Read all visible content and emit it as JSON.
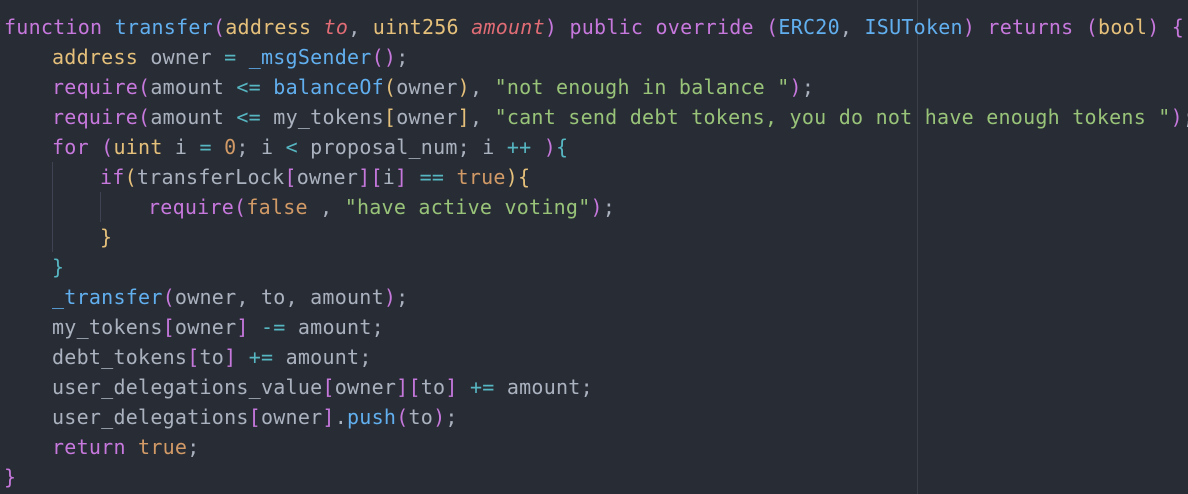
{
  "editor": {
    "background": "#282c34",
    "theme_colors": {
      "keyword": "#c678dd",
      "type": "#e5c07b",
      "function": "#61afef",
      "parameter": "#e06c75",
      "string": "#98c379",
      "number": "#d19a66",
      "operator": "#56b6c2",
      "plain": "#abb2bf"
    },
    "lines": [
      {
        "indent": 0,
        "tokens": [
          {
            "t": "function",
            "c": "#c678dd"
          },
          {
            "t": " ",
            "c": "#abb2bf"
          },
          {
            "t": "transfer",
            "c": "#61afef"
          },
          {
            "t": "(",
            "c": "#c678dd"
          },
          {
            "t": "address",
            "c": "#e5c07b"
          },
          {
            "t": " ",
            "c": "#abb2bf"
          },
          {
            "t": "to",
            "c": "#e06c75",
            "italic": true
          },
          {
            "t": ", ",
            "c": "#abb2bf"
          },
          {
            "t": "uint256",
            "c": "#e5c07b"
          },
          {
            "t": " ",
            "c": "#abb2bf"
          },
          {
            "t": "amount",
            "c": "#e06c75",
            "italic": true
          },
          {
            "t": ")",
            "c": "#c678dd"
          },
          {
            "t": " public override ",
            "c": "#c678dd"
          },
          {
            "t": "(",
            "c": "#c678dd"
          },
          {
            "t": "ERC20",
            "c": "#61afef"
          },
          {
            "t": ", ",
            "c": "#abb2bf"
          },
          {
            "t": "ISUToken",
            "c": "#61afef"
          },
          {
            "t": ")",
            "c": "#c678dd"
          },
          {
            "t": " returns ",
            "c": "#c678dd"
          },
          {
            "t": "(",
            "c": "#c678dd"
          },
          {
            "t": "bool",
            "c": "#e5c07b"
          },
          {
            "t": ")",
            "c": "#c678dd"
          },
          {
            "t": " ",
            "c": "#abb2bf"
          },
          {
            "t": "{",
            "c": "#c678dd"
          }
        ]
      },
      {
        "indent": 1,
        "tokens": [
          {
            "t": "address",
            "c": "#e5c07b"
          },
          {
            "t": " owner ",
            "c": "#abb2bf"
          },
          {
            "t": "=",
            "c": "#56b6c2"
          },
          {
            "t": " ",
            "c": "#abb2bf"
          },
          {
            "t": "_msgSender",
            "c": "#61afef"
          },
          {
            "t": "()",
            "c": "#c678dd"
          },
          {
            "t": ";",
            "c": "#abb2bf"
          }
        ]
      },
      {
        "indent": 1,
        "tokens": [
          {
            "t": "require",
            "c": "#c678dd"
          },
          {
            "t": "(",
            "c": "#c678dd"
          },
          {
            "t": "amount ",
            "c": "#abb2bf"
          },
          {
            "t": "<=",
            "c": "#56b6c2"
          },
          {
            "t": " ",
            "c": "#abb2bf"
          },
          {
            "t": "balanceOf",
            "c": "#61afef"
          },
          {
            "t": "(",
            "c": "#e5c07b"
          },
          {
            "t": "owner",
            "c": "#abb2bf"
          },
          {
            "t": ")",
            "c": "#e5c07b"
          },
          {
            "t": ", ",
            "c": "#abb2bf"
          },
          {
            "t": "\"not enough in balance \"",
            "c": "#98c379"
          },
          {
            "t": ")",
            "c": "#c678dd"
          },
          {
            "t": ";",
            "c": "#abb2bf"
          }
        ]
      },
      {
        "indent": 1,
        "tokens": [
          {
            "t": "require",
            "c": "#c678dd"
          },
          {
            "t": "(",
            "c": "#c678dd"
          },
          {
            "t": "amount ",
            "c": "#abb2bf"
          },
          {
            "t": "<=",
            "c": "#56b6c2"
          },
          {
            "t": " my_tokens",
            "c": "#abb2bf"
          },
          {
            "t": "[",
            "c": "#e5c07b"
          },
          {
            "t": "owner",
            "c": "#abb2bf"
          },
          {
            "t": "]",
            "c": "#e5c07b"
          },
          {
            "t": ", ",
            "c": "#abb2bf"
          },
          {
            "t": "\"cant send debt tokens, you do not have enough tokens \"",
            "c": "#98c379"
          },
          {
            "t": ")",
            "c": "#c678dd"
          },
          {
            "t": ";",
            "c": "#abb2bf"
          }
        ]
      },
      {
        "indent": 1,
        "tokens": [
          {
            "t": "for",
            "c": "#c678dd"
          },
          {
            "t": " ",
            "c": "#abb2bf"
          },
          {
            "t": "(",
            "c": "#c678dd"
          },
          {
            "t": "uint",
            "c": "#e5c07b"
          },
          {
            "t": " i ",
            "c": "#abb2bf"
          },
          {
            "t": "=",
            "c": "#56b6c2"
          },
          {
            "t": " ",
            "c": "#abb2bf"
          },
          {
            "t": "0",
            "c": "#d19a66"
          },
          {
            "t": "; i ",
            "c": "#abb2bf"
          },
          {
            "t": "<",
            "c": "#56b6c2"
          },
          {
            "t": " proposal_num; i ",
            "c": "#abb2bf"
          },
          {
            "t": "++",
            "c": "#56b6c2"
          },
          {
            "t": " ",
            "c": "#abb2bf"
          },
          {
            "t": ")",
            "c": "#c678dd"
          },
          {
            "t": "{",
            "c": "#56b6c2"
          }
        ]
      },
      {
        "indent": 2,
        "tokens": [
          {
            "t": "if",
            "c": "#c678dd"
          },
          {
            "t": "(",
            "c": "#e5c07b"
          },
          {
            "t": "transferLock",
            "c": "#abb2bf"
          },
          {
            "t": "[",
            "c": "#c678dd"
          },
          {
            "t": "owner",
            "c": "#abb2bf"
          },
          {
            "t": "][",
            "c": "#c678dd"
          },
          {
            "t": "i",
            "c": "#abb2bf"
          },
          {
            "t": "]",
            "c": "#c678dd"
          },
          {
            "t": " ",
            "c": "#abb2bf"
          },
          {
            "t": "==",
            "c": "#56b6c2"
          },
          {
            "t": " ",
            "c": "#abb2bf"
          },
          {
            "t": "true",
            "c": "#d19a66"
          },
          {
            "t": ")",
            "c": "#e5c07b"
          },
          {
            "t": "{",
            "c": "#e5c07b"
          }
        ]
      },
      {
        "indent": 3,
        "tokens": [
          {
            "t": "require",
            "c": "#c678dd"
          },
          {
            "t": "(",
            "c": "#c678dd"
          },
          {
            "t": "false",
            "c": "#d19a66"
          },
          {
            "t": " , ",
            "c": "#abb2bf"
          },
          {
            "t": "\"have active voting\"",
            "c": "#98c379"
          },
          {
            "t": ")",
            "c": "#c678dd"
          },
          {
            "t": ";",
            "c": "#abb2bf"
          }
        ]
      },
      {
        "indent": 2,
        "tokens": [
          {
            "t": "}",
            "c": "#e5c07b"
          }
        ]
      },
      {
        "indent": 1,
        "tokens": [
          {
            "t": "}",
            "c": "#56b6c2"
          }
        ]
      },
      {
        "indent": 1,
        "tokens": [
          {
            "t": "_transfer",
            "c": "#61afef"
          },
          {
            "t": "(",
            "c": "#c678dd"
          },
          {
            "t": "owner, to, amount",
            "c": "#abb2bf"
          },
          {
            "t": ")",
            "c": "#c678dd"
          },
          {
            "t": ";",
            "c": "#abb2bf"
          }
        ]
      },
      {
        "indent": 1,
        "tokens": [
          {
            "t": "my_tokens",
            "c": "#abb2bf"
          },
          {
            "t": "[",
            "c": "#c678dd"
          },
          {
            "t": "owner",
            "c": "#abb2bf"
          },
          {
            "t": "]",
            "c": "#c678dd"
          },
          {
            "t": " ",
            "c": "#abb2bf"
          },
          {
            "t": "-=",
            "c": "#56b6c2"
          },
          {
            "t": " amount;",
            "c": "#abb2bf"
          }
        ]
      },
      {
        "indent": 1,
        "tokens": [
          {
            "t": "debt_tokens",
            "c": "#abb2bf"
          },
          {
            "t": "[",
            "c": "#c678dd"
          },
          {
            "t": "to",
            "c": "#abb2bf"
          },
          {
            "t": "]",
            "c": "#c678dd"
          },
          {
            "t": " ",
            "c": "#abb2bf"
          },
          {
            "t": "+=",
            "c": "#56b6c2"
          },
          {
            "t": " amount;",
            "c": "#abb2bf"
          }
        ]
      },
      {
        "indent": 1,
        "tokens": [
          {
            "t": "user_delegations_value",
            "c": "#abb2bf"
          },
          {
            "t": "[",
            "c": "#c678dd"
          },
          {
            "t": "owner",
            "c": "#abb2bf"
          },
          {
            "t": "][",
            "c": "#c678dd"
          },
          {
            "t": "to",
            "c": "#abb2bf"
          },
          {
            "t": "]",
            "c": "#c678dd"
          },
          {
            "t": " ",
            "c": "#abb2bf"
          },
          {
            "t": "+=",
            "c": "#56b6c2"
          },
          {
            "t": " amount;",
            "c": "#abb2bf"
          }
        ]
      },
      {
        "indent": 1,
        "tokens": [
          {
            "t": "user_delegations",
            "c": "#abb2bf"
          },
          {
            "t": "[",
            "c": "#c678dd"
          },
          {
            "t": "owner",
            "c": "#abb2bf"
          },
          {
            "t": "]",
            "c": "#c678dd"
          },
          {
            "t": ".",
            "c": "#abb2bf"
          },
          {
            "t": "push",
            "c": "#61afef"
          },
          {
            "t": "(",
            "c": "#c678dd"
          },
          {
            "t": "to",
            "c": "#abb2bf"
          },
          {
            "t": ")",
            "c": "#c678dd"
          },
          {
            "t": ";",
            "c": "#abb2bf"
          }
        ]
      },
      {
        "indent": 1,
        "tokens": [
          {
            "t": "return",
            "c": "#c678dd"
          },
          {
            "t": " ",
            "c": "#abb2bf"
          },
          {
            "t": "true",
            "c": "#d19a66"
          },
          {
            "t": ";",
            "c": "#abb2bf"
          }
        ]
      },
      {
        "indent": 0,
        "tokens": [
          {
            "t": "}",
            "c": "#c678dd"
          }
        ]
      }
    ]
  }
}
